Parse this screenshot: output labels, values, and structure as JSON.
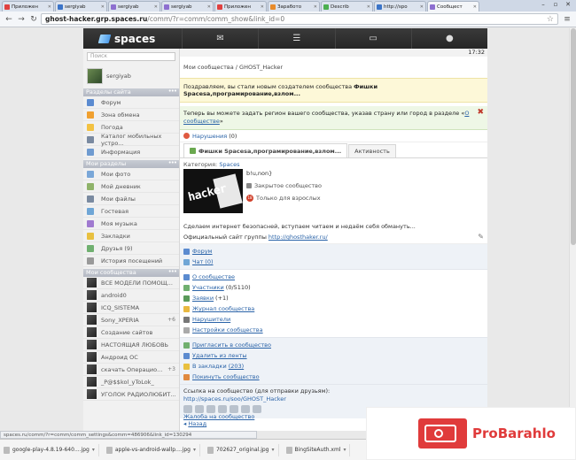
{
  "browser": {
    "tabs": [
      {
        "title": "Приложен",
        "color": "#e04040",
        "active": false
      },
      {
        "title": "sergiyab",
        "color": "#3b74c8",
        "active": false
      },
      {
        "title": "sergiyab",
        "color": "#8d6fd0",
        "active": false
      },
      {
        "title": "sergiyab",
        "color": "#8d6fd0",
        "active": false
      },
      {
        "title": "Приложен",
        "color": "#e04040",
        "active": false
      },
      {
        "title": "Заработо",
        "color": "#e88b2a",
        "active": false
      },
      {
        "title": "Describ",
        "color": "#4caf50",
        "active": false
      },
      {
        "title": "http://spo",
        "color": "#3b74c8",
        "active": false
      },
      {
        "title": "Сообщест",
        "color": "#8d6fd0",
        "active": true
      }
    ],
    "url_host": "ghost-hacker.grp.spaces.ru",
    "url_path": "/comm/?r=comm/comm_show&link_id=0",
    "status_url": "spaces.ru/comm/?r=comm/comm_settings&comm=486906&link_id=130294"
  },
  "topnav": {
    "logo": "spaces",
    "icons": [
      "mail-icon",
      "feed-icon",
      "notepad-icon",
      "user-icon"
    ],
    "time": "17:32"
  },
  "sidebar": {
    "search_placeholder": "Поиск",
    "username": "sergiyab",
    "site_header": "Разделы сайта",
    "site_items": [
      {
        "label": "Форум",
        "color": "#5b8bd0"
      },
      {
        "label": "Зона обмена",
        "color": "#f0a030"
      },
      {
        "label": "Погода",
        "color": "#f3c242"
      },
      {
        "label": "Каталог мобильных устро...",
        "color": "#7a8aa0"
      },
      {
        "label": "Информация",
        "color": "#6f9bd0"
      }
    ],
    "my_header": "Мои разделы",
    "my_items": [
      {
        "label": "Мои фото",
        "color": "#7aa7d8",
        "count": ""
      },
      {
        "label": "Мой дневник",
        "color": "#8fb36a",
        "count": ""
      },
      {
        "label": "Мои файлы",
        "color": "#7a8aa0",
        "count": ""
      },
      {
        "label": "Гостевая",
        "color": "#6fa6d6",
        "count": ""
      },
      {
        "label": "Моя музыка",
        "color": "#a07ad0",
        "count": ""
      },
      {
        "label": "Закладки",
        "color": "#e8c040",
        "count": ""
      },
      {
        "label": "Друзья (9)",
        "color": "#70b070",
        "count": ""
      },
      {
        "label": "История посещений",
        "color": "#999999",
        "count": ""
      }
    ],
    "comm_header": "Мои сообщества",
    "comm_items": [
      {
        "label": "ВСЕ МОДЕЛИ ПОМОЩ...",
        "count": ""
      },
      {
        "label": "android0",
        "count": ""
      },
      {
        "label": "ICQ_SISTEMA",
        "count": ""
      },
      {
        "label": "Sony_XPERIA",
        "count": "+6"
      },
      {
        "label": "Создание сайтов",
        "count": ""
      },
      {
        "label": "НАСТОЯЩАЯ ЛЮБОВЬ",
        "count": ""
      },
      {
        "label": "Андроид ОС",
        "count": ""
      },
      {
        "label": "скачать Операцио...",
        "count": "+3"
      },
      {
        "label": "_P@$$kol_yToLok_",
        "count": ""
      },
      {
        "label": "УГОЛОК РАДИОЛЮБИТ...",
        "count": ""
      }
    ]
  },
  "main": {
    "breadcrumb": "Мои сообщества / GHOST_Hacker",
    "congrats_prefix": "Поздравляем, вы стали новым создателем сообщества ",
    "congrats_name": "Фишки Spacesa,програмирование,взлом...",
    "region_text": "Теперь вы можете задать регион вашего сообщества, указав страну или город в разделе «",
    "region_link": "О сообществе",
    "region_suffix": "»",
    "violations": "Нарушения",
    "violations_count": "(0)",
    "tab_main": "Фишки Spacesa,програмирование,взлом...",
    "tab_activity": "Активность",
    "category_label": "Категория:",
    "category_value": "Spaces",
    "community_handle": "b!u,non}",
    "hero_image_text": "hacker",
    "closed": "Закрытое сообщество",
    "adults": "Только для взрослых",
    "adult_badge": "18",
    "description": "Сделаем интернет безопасней, вступаем читаем и недаём себя обмануть...",
    "site_label": "Официальный сайт группы",
    "site_link": "http://ghosthaker.ru/",
    "links_a": [
      {
        "label": "Форум",
        "color": "#5b8bd0"
      },
      {
        "label": "Чат (0)",
        "color": "#6fa6d6"
      }
    ],
    "links_b": [
      {
        "label": "О сообществе",
        "color": "#5b8bd0",
        "plain": ""
      },
      {
        "label": "Участники",
        "color": "#70b070",
        "plain": "(0/5110)"
      },
      {
        "label": "Заявки",
        "color": "#5a9a5a",
        "plain": "(+1)"
      },
      {
        "label": "Журнал сообщества",
        "color": "#e8b840",
        "plain": ""
      },
      {
        "label": "Нарушители",
        "color": "#777777",
        "plain": ""
      },
      {
        "label": "Настройки сообщества",
        "color": "#aaaaaa",
        "plain": "",
        "red": true
      }
    ],
    "links_c": [
      {
        "label": "Пригласить в сообщество",
        "color": "#70b070",
        "pre": "",
        "post": ""
      },
      {
        "label": "Удалить из ленты",
        "color": "#5b8bd0",
        "pre": "",
        "post": ""
      },
      {
        "label": "В закладки",
        "color": "#e8c040",
        "pre": "",
        "post": "(203)"
      },
      {
        "label": "Покинуть сообщество",
        "color": "#e08a40",
        "pre": "",
        "post": ""
      }
    ],
    "share_label": "Ссылка на сообщество (для отправки друзьям):",
    "share_link": "http://spaces.ru/soo/GHOST_Hacker",
    "complaint": "Жалоба на сообщество",
    "back": "Назад"
  },
  "downloads": [
    {
      "name": "google-play-4.8.19-640....jpg"
    },
    {
      "name": "apple-vs-android-wallp....jpg"
    },
    {
      "name": "702627_original.jpg"
    },
    {
      "name": "BingSiteAuth.xml"
    }
  ],
  "ad": {
    "label": "ProBarahlo",
    "accent": "#e03b3b"
  }
}
